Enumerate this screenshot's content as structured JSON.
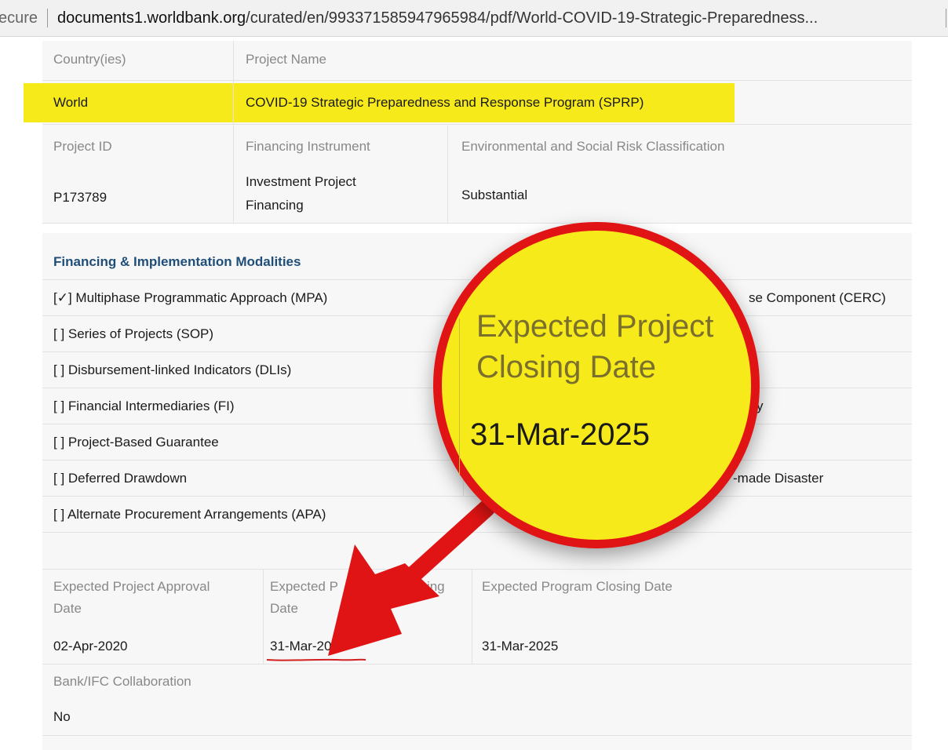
{
  "browser": {
    "security_label": "ecure",
    "url_domain": "documents1.worldbank.org",
    "url_path": "/curated/en/993371585947965984/pdf/World-COVID-19-Strategic-Preparedness..."
  },
  "project": {
    "countries_label": "Country(ies)",
    "project_name_label": "Project Name",
    "countries_value": "World",
    "project_name_value": "COVID-19 Strategic Preparedness and Response Program (SPRP)",
    "project_id_label": "Project ID",
    "financing_instrument_label": "Financing Instrument",
    "es_risk_label": "Environmental and Social Risk Classification",
    "project_id_value": "P173789",
    "financing_instrument_value_line1": "Investment Project",
    "financing_instrument_value_line2": "Financing",
    "es_risk_value": "Substantial"
  },
  "modalities": {
    "title": "Financing & Implementation Modalities",
    "left": [
      "[✓] Multiphase Programmatic Approach (MPA)",
      "[ ] Series of Projects (SOP)",
      "[ ] Disbursement-linked Indicators (DLIs)",
      "[ ] Financial Intermediaries (FI)",
      "[ ] Project-Based Guarantee",
      "[ ] Deferred Drawdown",
      "[ ] Alternate Procurement Arrangements (APA)"
    ],
    "right_partial": {
      "row1": "se Component  (CERC)",
      "row4": "y",
      "row6": "-made Disaster"
    }
  },
  "dates": {
    "approval_label_line1": "Expected Project Approval",
    "approval_label_line2": "Date",
    "closing_label_part1": "Expected P",
    "closing_label_part2": "osing",
    "closing_label_line2": "Date",
    "program_closing_label": "Expected Program Closing Date",
    "approval_value": "02-Apr-2020",
    "closing_value": "31-Mar-2025",
    "program_closing_value": "31-Mar-2025"
  },
  "collab": {
    "label": "Bank/IFC Collaboration",
    "value": "No"
  },
  "callout": {
    "line1": "Expected Project",
    "line2": "Closing  Date",
    "date": "31-Mar-2025"
  },
  "colors": {
    "highlight": "#f7ea1a",
    "annotation_red": "#e01414",
    "section_title": "#1f4e79"
  }
}
